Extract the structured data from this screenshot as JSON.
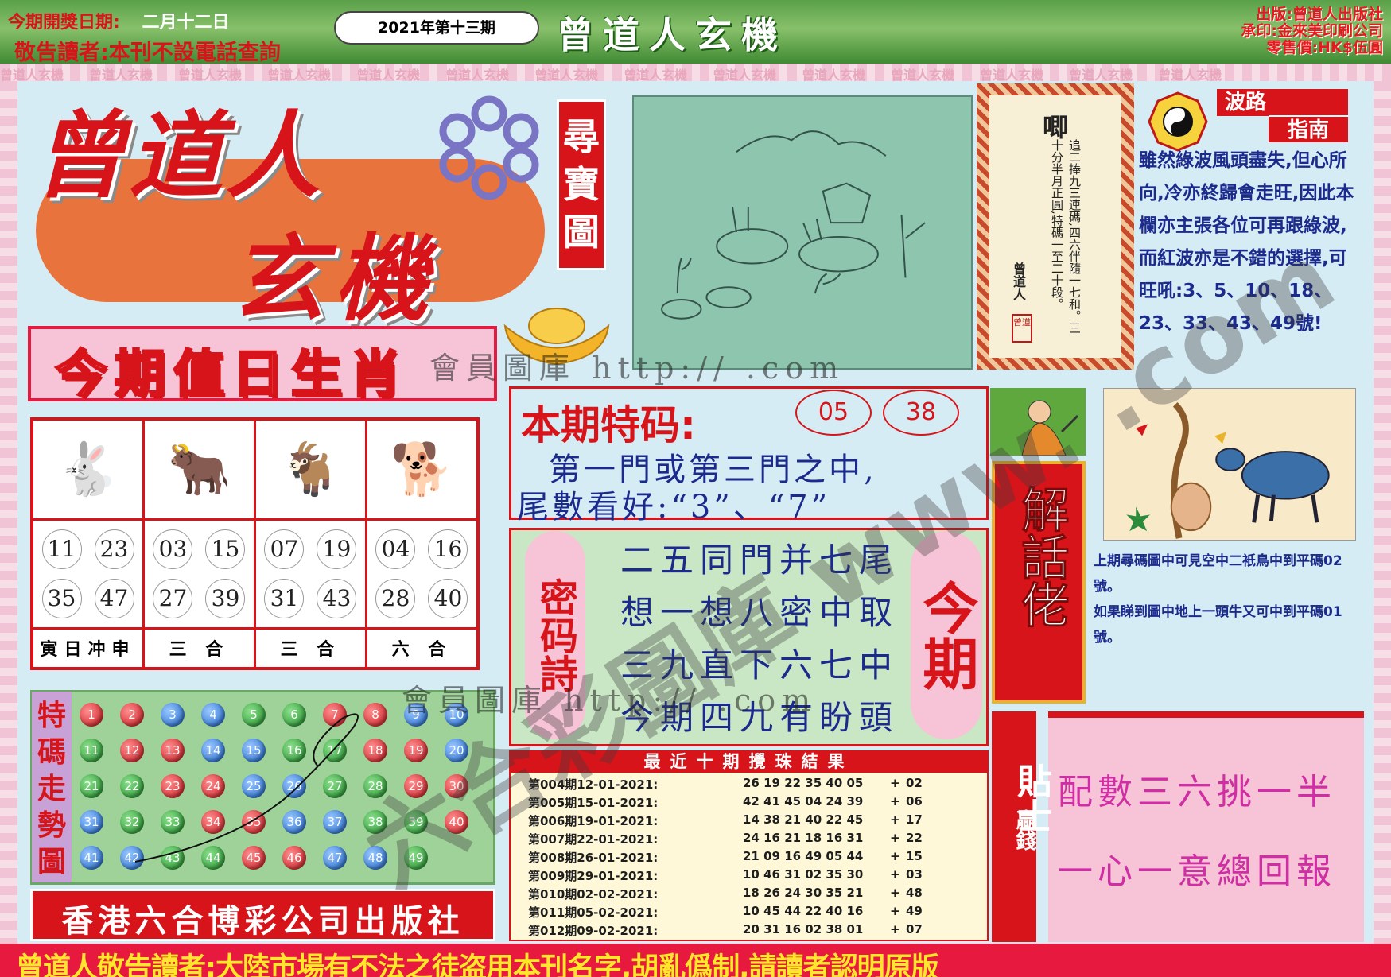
{
  "header": {
    "draw_date_label": "今期開獎日期:",
    "draw_date": "二月十二日",
    "notice": "敬告讀者:本刊不設電話查詢",
    "issue": "2021年第十三期",
    "brand": "曾道人玄機",
    "publisher_line": "出版:曾道人出版社",
    "printer_line": "承印:金來美印刷公司",
    "price_line": "零售價:HK$伍圓"
  },
  "border_text": "曾道人玄機",
  "masthead": {
    "line1": "曾道人",
    "line2": "玄機",
    "treasure_map_label": "尋寶圖"
  },
  "zodiac": {
    "title": "今期值日生肖",
    "columns": [
      {
        "animal_icon": "rabbit-icon",
        "glyph": "🐇",
        "numbers": [
          "11",
          "23",
          "35",
          "47"
        ],
        "footer": "寅日冲申"
      },
      {
        "animal_icon": "ox-icon",
        "glyph": "🐂",
        "numbers": [
          "03",
          "15",
          "27",
          "39"
        ],
        "footer": "三 合"
      },
      {
        "animal_icon": "goat-icon",
        "glyph": "🐐",
        "numbers": [
          "07",
          "19",
          "31",
          "43"
        ],
        "footer": "三 合"
      },
      {
        "animal_icon": "dog-icon",
        "glyph": "🐕",
        "numbers": [
          "04",
          "16",
          "28",
          "40"
        ],
        "footer": "六 合"
      }
    ]
  },
  "trend": {
    "label": "特碼走勢圖",
    "balls": [
      {
        "n": "1",
        "c": "red"
      },
      {
        "n": "2",
        "c": "red"
      },
      {
        "n": "3",
        "c": "blue"
      },
      {
        "n": "4",
        "c": "blue"
      },
      {
        "n": "5",
        "c": "green"
      },
      {
        "n": "6",
        "c": "green"
      },
      {
        "n": "7",
        "c": "red"
      },
      {
        "n": "8",
        "c": "red"
      },
      {
        "n": "9",
        "c": "blue"
      },
      {
        "n": "10",
        "c": "blue"
      },
      {
        "n": "11",
        "c": "green"
      },
      {
        "n": "12",
        "c": "red"
      },
      {
        "n": "13",
        "c": "red"
      },
      {
        "n": "14",
        "c": "blue"
      },
      {
        "n": "15",
        "c": "blue"
      },
      {
        "n": "16",
        "c": "green"
      },
      {
        "n": "17",
        "c": "green"
      },
      {
        "n": "18",
        "c": "red"
      },
      {
        "n": "19",
        "c": "red"
      },
      {
        "n": "20",
        "c": "blue"
      },
      {
        "n": "21",
        "c": "green"
      },
      {
        "n": "22",
        "c": "green"
      },
      {
        "n": "23",
        "c": "red"
      },
      {
        "n": "24",
        "c": "red"
      },
      {
        "n": "25",
        "c": "blue"
      },
      {
        "n": "26",
        "c": "blue"
      },
      {
        "n": "27",
        "c": "green"
      },
      {
        "n": "28",
        "c": "green"
      },
      {
        "n": "29",
        "c": "red"
      },
      {
        "n": "30",
        "c": "red"
      },
      {
        "n": "31",
        "c": "blue"
      },
      {
        "n": "32",
        "c": "green"
      },
      {
        "n": "33",
        "c": "green"
      },
      {
        "n": "34",
        "c": "red"
      },
      {
        "n": "35",
        "c": "red"
      },
      {
        "n": "36",
        "c": "blue"
      },
      {
        "n": "37",
        "c": "blue"
      },
      {
        "n": "38",
        "c": "green"
      },
      {
        "n": "39",
        "c": "green"
      },
      {
        "n": "40",
        "c": "red"
      },
      {
        "n": "41",
        "c": "blue"
      },
      {
        "n": "42",
        "c": "blue"
      },
      {
        "n": "43",
        "c": "green"
      },
      {
        "n": "44",
        "c": "green"
      },
      {
        "n": "45",
        "c": "red"
      },
      {
        "n": "46",
        "c": "red"
      },
      {
        "n": "47",
        "c": "blue"
      },
      {
        "n": "48",
        "c": "blue"
      },
      {
        "n": "49",
        "c": "green"
      }
    ]
  },
  "publisher": "香港六合博彩公司出版社",
  "scroll": {
    "head": "唧",
    "text": "追二捧九三連碼,四六伴隨一七和。三十分半月正圓,特碼一至二十段。",
    "signature": "曾道人",
    "seal": "曾道"
  },
  "wave_guide": {
    "title_1": "波路",
    "title_2": "指南",
    "text": "雖然綠波風頭盡失,但心所向,冷亦終歸會走旺,因此本欄亦主張各位可再跟綠波,而紅波亦是不錯的選擇,可旺吼:3、5、10、18、23、33、43、49號!"
  },
  "special_code": {
    "title": "本期特码:",
    "numbers": [
      "05",
      "38"
    ],
    "line1": "第一門或第三門之中,",
    "line2": "尾數看好:“3”、“7”"
  },
  "poem": {
    "label": "密码詩",
    "lines": [
      "二五同門并七尾",
      "想一想八密中取",
      "三九直下六七中",
      "今期四九有盼頭"
    ],
    "today_label": "今期"
  },
  "results": {
    "title": "最近十期攪珠結果",
    "rows": [
      {
        "issue": "第004期12-01-2021:",
        "nums": "26 19 22 35 40 05",
        "special": "02"
      },
      {
        "issue": "第005期15-01-2021:",
        "nums": "42 41 45 04 24 39",
        "special": "06"
      },
      {
        "issue": "第006期19-01-2021:",
        "nums": "14 38 21 40 22 45",
        "special": "17"
      },
      {
        "issue": "第007期22-01-2021:",
        "nums": "24 16 21 18 16 31",
        "special": "22"
      },
      {
        "issue": "第008期26-01-2021:",
        "nums": "21 09 16 49 05 44",
        "special": "15"
      },
      {
        "issue": "第009期29-01-2021:",
        "nums": "10 46 31 02 35 30",
        "special": "03"
      },
      {
        "issue": "第010期02-02-2021:",
        "nums": "18 26 24 30 35 21",
        "special": "48"
      },
      {
        "issue": "第011期05-02-2021:",
        "nums": "10 45 44 22 40 16",
        "special": "49"
      },
      {
        "issue": "第012期09-02-2021:",
        "nums": "20 31 16 02 38 01",
        "special": "07"
      }
    ]
  },
  "decoder": {
    "title": "解話佬"
  },
  "last_issue": {
    "line1": "上期尋碼圖中可見空中二衹鳥中到平碼02號。",
    "line2": "如果睇到圖中地上一頭牛又可中到平碼01號。"
  },
  "winning_tip": {
    "win_label": "贏錢",
    "tip_label": "貼士",
    "line1": "配數三六挑一半",
    "line2": "一心一意總回報"
  },
  "bottom_warning": "曾道人敬告讀者:大陸市場有不法之徒盗用本刊名字,胡亂僞制,請讀者認明原版",
  "watermarks": {
    "line_1": "會員圖庫 http://   .com",
    "line_2": "會員圖庫 http://   .com",
    "diagonal": "六合彩圖庫 www.  .com"
  },
  "colors": {
    "brand_red": "#d8141b",
    "text_blue": "#1b2a8c",
    "pink": "#f6c4d6",
    "green_bar": "#5aa14a"
  }
}
